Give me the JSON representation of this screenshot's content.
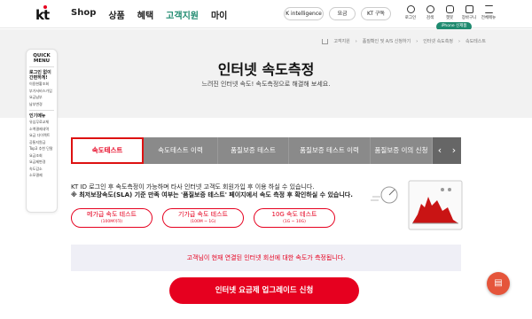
{
  "header": {
    "logo": "kt",
    "nav": [
      "Shop",
      "상품",
      "혜택",
      "고객지원",
      "마이"
    ],
    "active_nav": "고객지원",
    "pills": [
      "K intelligence",
      "요금",
      "KT 구독"
    ],
    "icons": [
      {
        "name": "login-icon",
        "label": "로그인"
      },
      {
        "name": "search-icon",
        "label": "검색"
      },
      {
        "name": "chatbot-icon",
        "label": "챗봇"
      },
      {
        "name": "cart-icon",
        "label": "장바구니"
      },
      {
        "name": "menu-icon",
        "label": "전체메뉴"
      }
    ],
    "promo": "iPhone 신제품"
  },
  "breadcrumb": [
    "고객지원",
    "품질확인 및 A/S 신청하기",
    "인터넷 속도측정",
    "속도테스트"
  ],
  "page": {
    "title": "인터넷 속도측정",
    "subtitle": "느려진 인터넷 속도! 속도측정으로 해결해 보세요."
  },
  "quick_menu": {
    "title": "QUICK MENU",
    "login_head": "로그인 없이 간편하게!",
    "login_items": [
      "이용현황조회",
      "부가서비스가입",
      "요금납부",
      "납부변경"
    ],
    "popular_head": "인기메뉴",
    "popular_items": [
      "유심무료교체",
      "소액결제내역",
      "요금 다이렉트",
      "공통지원금",
      "Top3 추천 단말",
      "요금조회",
      "요금제변경",
      "속도감소",
      "소모결제"
    ]
  },
  "tabs": [
    "속도테스트",
    "속도테스트 이력",
    "품질보증 테스트",
    "품질보증 테스트 이력",
    "품질보증 이의 신청"
  ],
  "active_tab": "속도테스트",
  "tab_arrows": [
    "‹",
    "›"
  ],
  "info": {
    "line1": "KT ID 로그인 후 속도측정이 가능하며 타사 인터넷 고객도 회원가입 후 이용 하실 수 있습니다.",
    "line2": "※ 최저보장속도(SLA) 기준 만족 여부는 '품질보증 테스트' 페이지에서 속도 측정 후 확인하실 수 있습니다."
  },
  "speed_buttons": [
    {
      "label": "메가급 속도 테스트",
      "sub": "(100M이하)"
    },
    {
      "label": "기가급 속도 테스트",
      "sub": "(100M ~ 1G)"
    },
    {
      "label": "10G 속도 테스트",
      "sub": "(1G ~ 10G)"
    }
  ],
  "status": "고객님이 현재 연결된 인터넷 회선에 대한 속도가 측정됩니다.",
  "cta": "인터넷 요금제 업그레이드 신청",
  "colors": {
    "accent": "#e6001f",
    "brand_green": "#1e8a6f",
    "tab_bg": "#8a8a8a"
  }
}
